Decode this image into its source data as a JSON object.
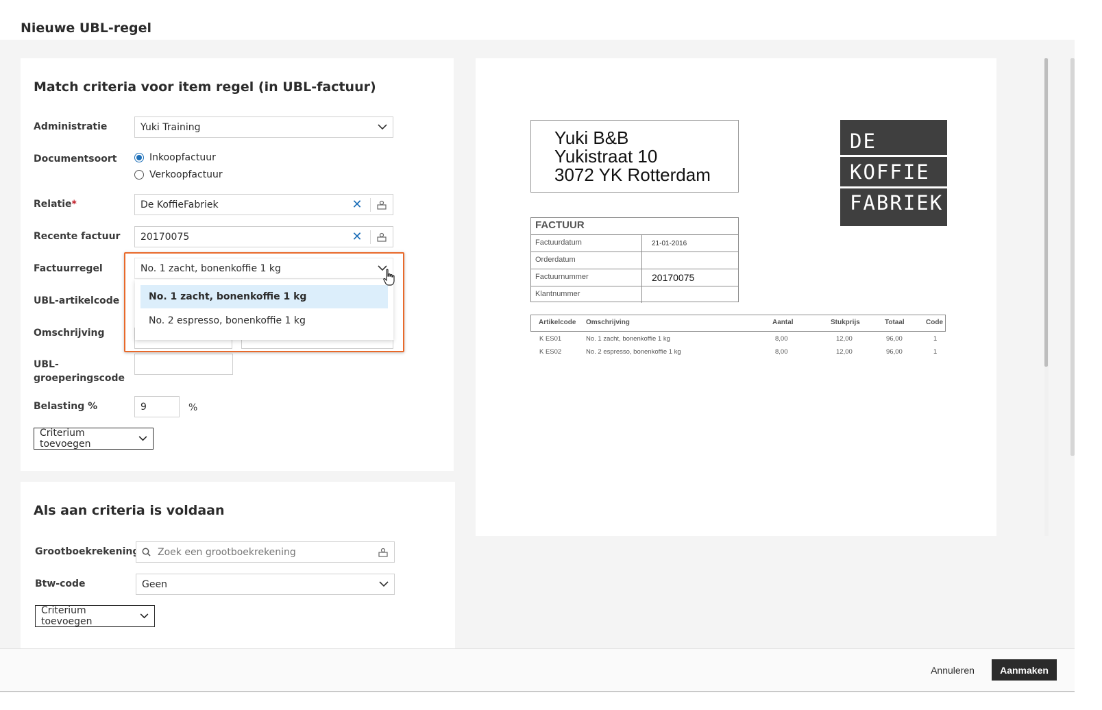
{
  "dialog": {
    "title": "Nieuwe UBL-regel"
  },
  "criteria": {
    "title": "Match criteria voor item regel (in UBL-factuur)",
    "administratie": {
      "label": "Administratie",
      "value": "Yuki Training"
    },
    "documentsoort": {
      "label": "Documentsoort",
      "options": [
        "Inkoopfactuur",
        "Verkoopfactuur"
      ],
      "selected": "Inkoopfactuur"
    },
    "relatie": {
      "label": "Relatie",
      "required_mark": "*",
      "value": "De KoffieFabriek"
    },
    "recente_factuur": {
      "label": "Recente factuur",
      "value": "20170075"
    },
    "factuurregel": {
      "label": "Factuurregel",
      "value": "No. 1 zacht, bonenkoffie 1 kg",
      "options": [
        "No. 1 zacht, bonenkoffie 1 kg",
        "No. 2 espresso, bonenkoffie 1 kg"
      ],
      "highlighted_index": 0
    },
    "ubl_artikelcode": {
      "label": "UBL-artikelcode"
    },
    "omschrijving": {
      "label": "Omschrijving"
    },
    "ubl_groeperingscode": {
      "label_line1": "UBL-",
      "label_line2": "groeperingscode",
      "value": ""
    },
    "belasting": {
      "label": "Belasting %",
      "value": "9",
      "unit": "%"
    },
    "add_button": "Criterium toevoegen"
  },
  "actions": {
    "title": "Als aan criteria is voldaan",
    "grootboekrekening": {
      "label": "Grootboekrekening",
      "placeholder": "Zoek een grootboekrekening"
    },
    "btw_code": {
      "label": "Btw-code",
      "value": "Geen"
    },
    "add_button": "Criterium toevoegen"
  },
  "invoice_preview": {
    "address": [
      "Yuki B&B",
      "Yukistraat 10",
      "3072 YK Rotterdam"
    ],
    "logo": [
      "DE",
      "KOFFIE",
      "FABRIEK"
    ],
    "heading": "FACTUUR",
    "fields": [
      {
        "key": "Factuurdatum",
        "value": "21-01-2016"
      },
      {
        "key": "Orderdatum",
        "value": ""
      },
      {
        "key": "Factuurnummer",
        "value": "20170075"
      },
      {
        "key": "Klantnummer",
        "value": ""
      }
    ],
    "columns": [
      "Artikelcode",
      "Omschrijving",
      "Aantal",
      "Stukprijs",
      "Totaal",
      "Code"
    ],
    "lines": [
      [
        "K ES01",
        "No. 1 zacht, bonenkoffie 1 kg",
        "8,00",
        "12,00",
        "96,00",
        "1"
      ],
      [
        "K ES02",
        "No. 2 espresso, bonenkoffie 1 kg",
        "8,00",
        "12,00",
        "96,00",
        "1"
      ]
    ]
  },
  "footer": {
    "cancel": "Annuleren",
    "create": "Aanmaken"
  },
  "colors": {
    "accent": "#1d6fb8",
    "highlight_border": "#e8692a",
    "primary_button": "#2b2b2b"
  }
}
